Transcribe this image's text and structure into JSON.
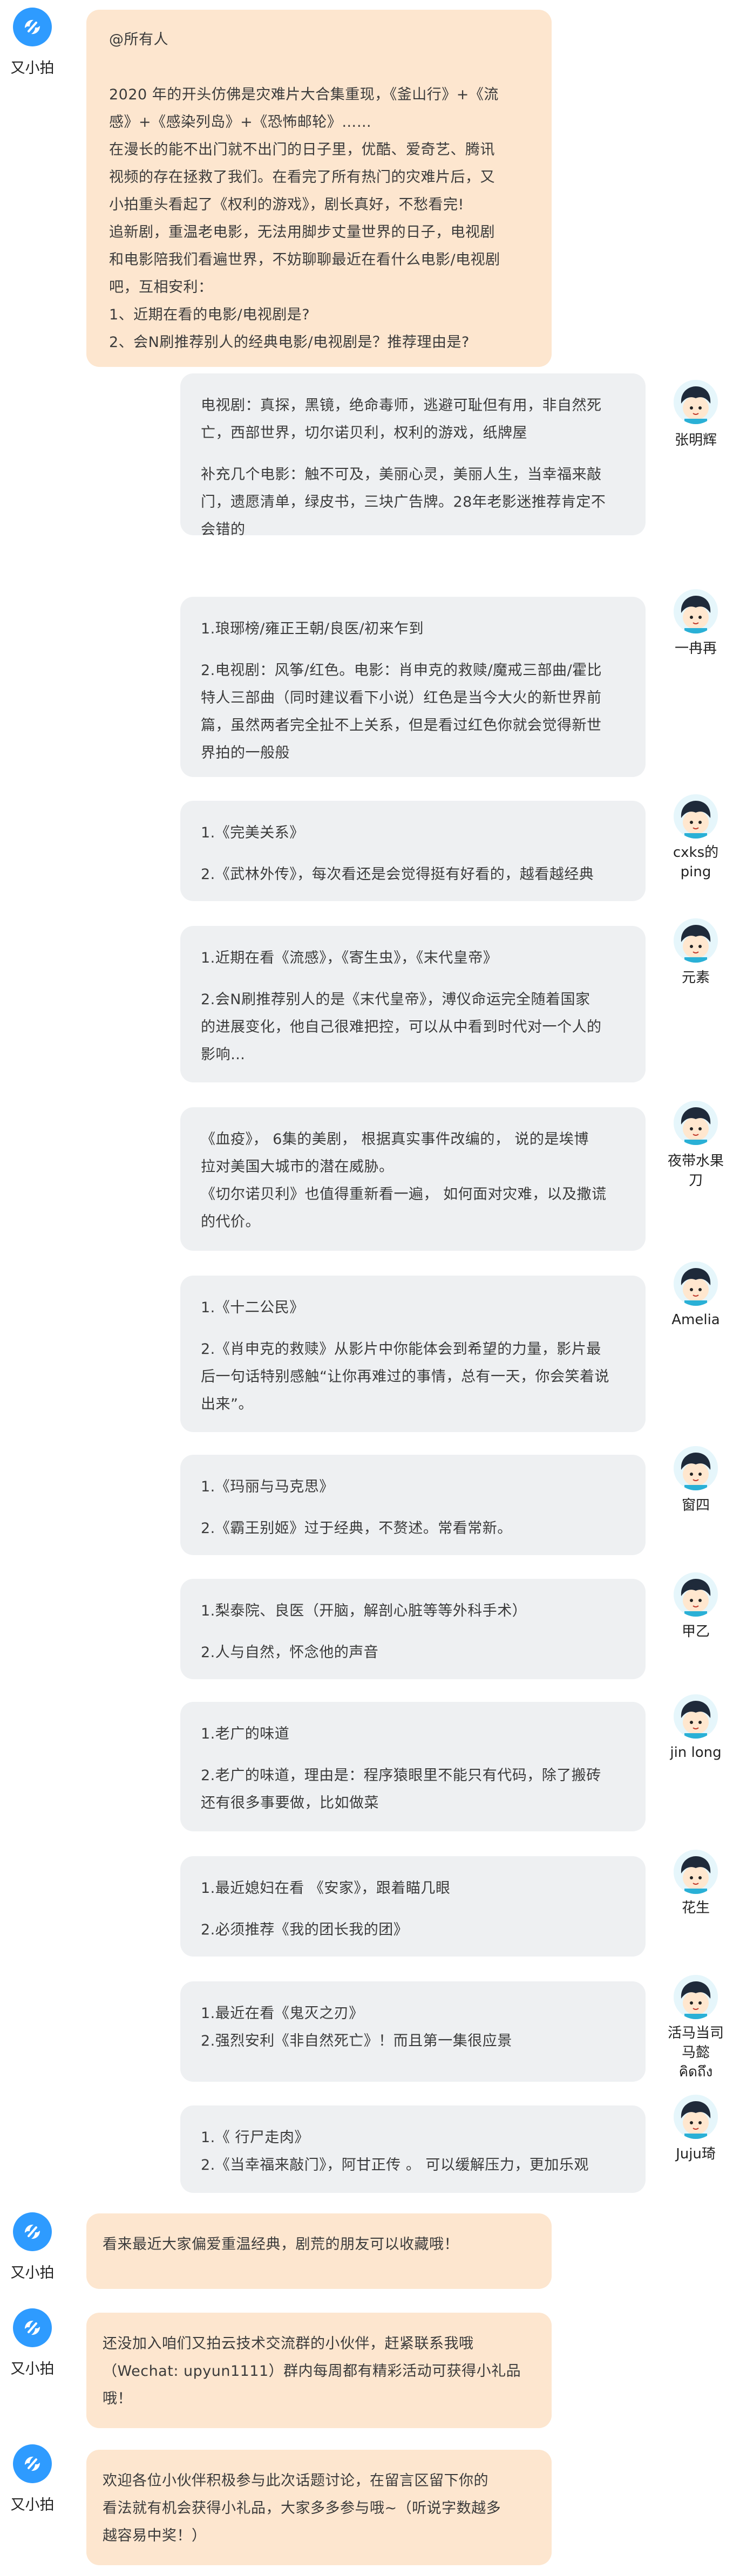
{
  "bot": {
    "name": "又小拍"
  },
  "intro": {
    "lines": [
      "@所有人",
      "",
      "2020 年的开头仿佛是灾难片大合集重现，《釜山行》+《流",
      "感》+《感染列岛》+《恐怖邮轮》……",
      "在漫长的能不出门就不出门的日子里，优酷、爱奇艺、腾讯",
      "视频的存在拯救了我们。在看完了所有热门的灾难片后，又",
      "小拍重头看起了《权利的游戏》，剧长真好，不愁看完!",
      "追新剧，重温老电影，无法用脚步丈量世界的日子，电视剧",
      "和电影陪我们看遍世界，不妨聊聊最近在看什么电影/电视剧",
      "吧，互相安利：",
      "1、近期在看的电影/电视剧是?",
      "2、会N刷推荐别人的经典电影/电视剧是？推荐理由是?"
    ]
  },
  "replies": [
    {
      "user": "张明辉",
      "paras": [
        [
          "电视剧：真探，黑镜，绝命毒师，逃避可耻但有用，非自然死",
          "亡，西部世界，切尔诺贝利，权利的游戏，纸牌屋"
        ],
        [
          "补充几个电影：触不可及，美丽心灵，美丽人生，当幸福来敲",
          "门，遗愿清单，绿皮书，三块广告牌。28年老影迷推荐肯定不",
          "会错的"
        ]
      ]
    },
    {
      "user": "一冉再",
      "paras": [
        [
          "1.琅琊榜/雍正王朝/良医/初来乍到"
        ],
        [
          "2.电视剧：风筝/红色。电影：肖申克的救赎/魔戒三部曲/霍比",
          "特人三部曲（同时建议看下小说）红色是当今大火的新世界前",
          "篇，虽然两者完全扯不上关系，但是看过红色你就会觉得新世",
          "界拍的一般般"
        ]
      ]
    },
    {
      "user": "cxks的ping",
      "paras": [
        [
          "1.《完美关系》"
        ],
        [
          "2.《武林外传》，每次看还是会觉得挺有好看的，越看越经典"
        ]
      ]
    },
    {
      "user": "元素",
      "paras": [
        [
          "1.近期在看《流感》，《寄生虫》，《末代皇帝》"
        ],
        [
          "2.会N刷推荐别人的是《末代皇帝》，溥仪命运完全随着国家",
          "的进展变化，他自己很难把控，可以从中看到时代对一个人的",
          "影响…"
        ]
      ]
    },
    {
      "user": "夜带水果刀",
      "paras": [
        [
          "《血疫》，  6集的美剧， 根据真实事件改编的， 说的是埃博",
          "拉对美国大城市的潜在威胁。",
          "《切尔诺贝利》也值得重新看一遍， 如何面对灾难，以及撒谎",
          "的代价。"
        ]
      ]
    },
    {
      "user": "Amelia",
      "paras": [
        [
          "1.《十二公民》"
        ],
        [
          "2.《肖申克的救赎》从影片中你能体会到希望的力量，影片最",
          "后一句话特别感触“让你再难过的事情，总有一天，你会笑着说",
          "出来”。"
        ]
      ]
    },
    {
      "user": "窗四",
      "paras": [
        [
          "1.《玛丽与马克思》"
        ],
        [
          "2.《霸王别姬》过于经典，不赘述。常看常新。"
        ]
      ]
    },
    {
      "user": "甲乙",
      "paras": [
        [
          "1.梨泰院、良医（开脑，解剖心脏等等外科手术）"
        ],
        [
          "2.人与自然，怀念他的声音"
        ]
      ]
    },
    {
      "user": "jin long",
      "paras": [
        [
          "1.老广的味道"
        ],
        [
          "2.老广的味道，理由是：程序猿眼里不能只有代码，除了搬砖",
          "还有很多事要做，比如做菜"
        ]
      ]
    },
    {
      "user": "花生",
      "paras": [
        [
          "1.最近媳妇在看 《安家》，跟着瞄几眼"
        ],
        [
          "2.必须推荐《我的团长我的团》"
        ]
      ]
    },
    {
      "user": "活马当司马懿 คิดถึง",
      "paras": [
        [
          "1.最近在看《鬼灭之刃》",
          "2.强烈安利《非自然死亡》！而且第一集很应景"
        ]
      ]
    },
    {
      "user": "Juju琦",
      "paras": [
        [
          "1.《 行尸走肉》",
          "2.《当幸福来敲门》，阿甘正传 。 可以缓解压力，更加乐观"
        ]
      ]
    }
  ],
  "outro": [
    {
      "lines": [
        "看来最近大家偏爱重温经典，剧荒的朋友可以收藏哦！"
      ]
    },
    {
      "lines": [
        "还没加入咱们又拍云技术交流群的小伙伴，赶紧联系我哦",
        "（Wechat: upyun1111）群内每周都有精彩活动可获得小礼品",
        "哦！"
      ]
    },
    {
      "lines": [
        "欢迎各位小伙伴积极参与此次话题讨论，在留言区留下你的",
        "看法就有机会获得小礼品，大家多多参与哦~（听说字数越多",
        "越容易中奖！）"
      ]
    }
  ],
  "colors": {
    "bot_bubble": "#fde6cf",
    "user_bubble": "#eef0f2",
    "bot_avatar": "#2e9bff"
  }
}
